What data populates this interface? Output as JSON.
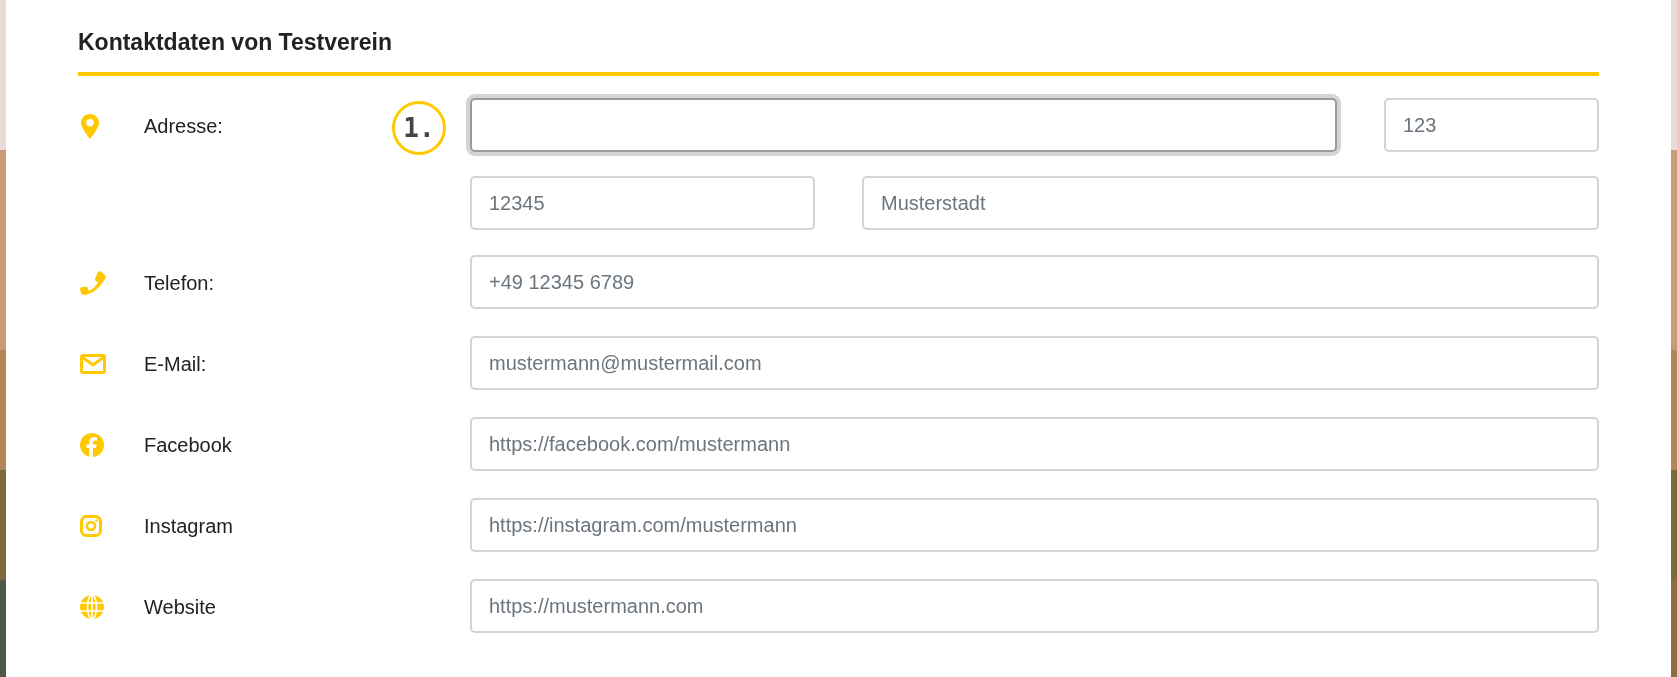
{
  "title": "Kontaktdaten von Testverein",
  "rows": [
    {
      "kind": "address",
      "label": "Adresse:",
      "badge": "1.",
      "lines": [
        [
          {
            "focused": true
          },
          {
            "placeholder": "123",
            "focused": false
          }
        ],
        [
          {
            "placeholder": "12345",
            "focused": false
          },
          {
            "placeholder": "Musterstadt",
            "focused": false
          }
        ]
      ]
    },
    {
      "kind": "phone",
      "label": "Telefon:",
      "field": {
        "placeholder": "+49 12345 6789",
        "focused": false
      }
    },
    {
      "kind": "email",
      "label": "E-Mail:",
      "field": {
        "placeholder": "mustermann@mustermail.com",
        "focused": false
      }
    },
    {
      "kind": "facebook",
      "label": "Facebook",
      "field": {
        "placeholder": "https://facebook.com/mustermann",
        "focused": false
      }
    },
    {
      "kind": "instagram",
      "label": "Instagram",
      "field": {
        "placeholder": "https://instagram.com/mustermann",
        "focused": false
      }
    },
    {
      "kind": "website",
      "label": "Website",
      "field": {
        "placeholder": "https://mustermann.com",
        "focused": false
      }
    }
  ]
}
